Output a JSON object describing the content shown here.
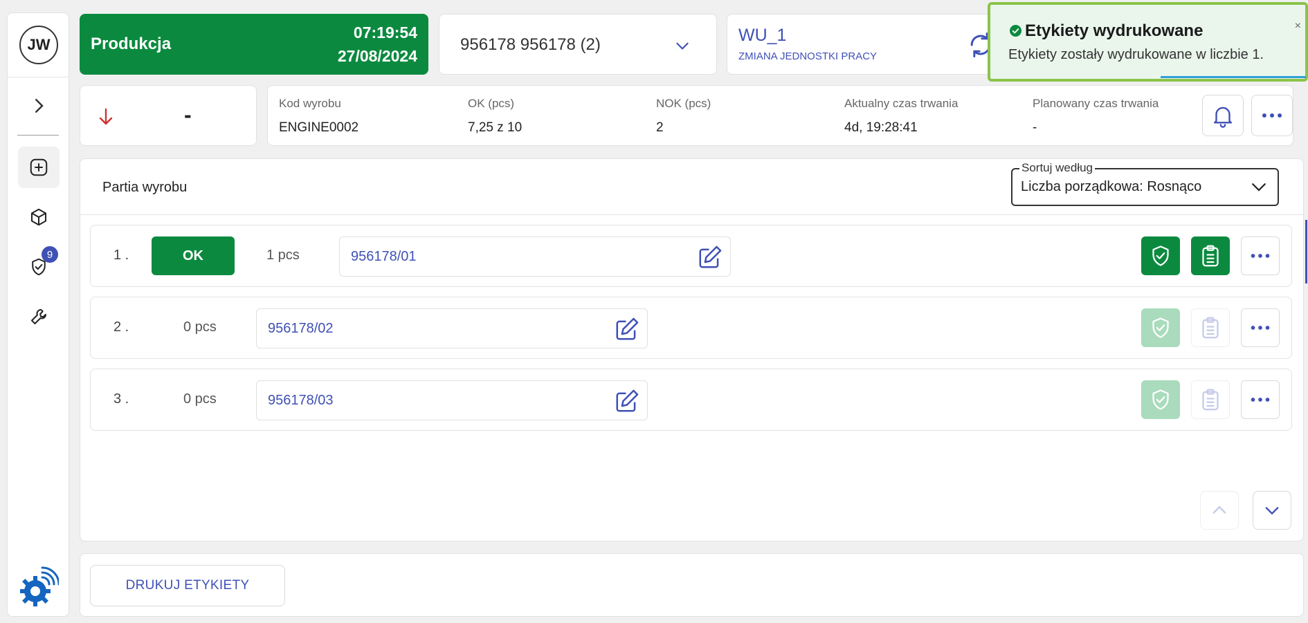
{
  "sidebar": {
    "avatar_initials": "JW",
    "notification_count": "9",
    "items": [
      {
        "icon": "chevron-right-icon"
      },
      {
        "icon": "plus-square-icon",
        "active": true
      },
      {
        "icon": "cube-icon"
      },
      {
        "icon": "shield-check-icon"
      },
      {
        "icon": "wrench-icon"
      }
    ]
  },
  "header": {
    "status_title": "Produkcja",
    "time": "07:19:54",
    "date": "27/08/2024",
    "order_label": "956178 956178  (2)",
    "work_unit_title": "WU_1",
    "work_unit_action": "ZMIANA JEDNOSTKI PRACY"
  },
  "toast": {
    "title": "Etykiety wydrukowane",
    "message": "Etykiety zostały wydrukowane w liczbie 1.",
    "close": "×"
  },
  "status": {
    "trend": "down",
    "value": "-"
  },
  "info": [
    {
      "label": "Kod wyrobu",
      "value": "ENGINE0002"
    },
    {
      "label": "OK (pcs)",
      "value": "7,25 z 10"
    },
    {
      "label": "NOK (pcs)",
      "value": "2"
    },
    {
      "label": "Aktualny czas trwania",
      "value": "4d, 19:28:41"
    },
    {
      "label": "Planowany czas trwania",
      "value": "-"
    }
  ],
  "partia": {
    "title": "Partia wyrobu",
    "sort_label": "Sortuj według",
    "sort_value": "Liczba porządkowa: Rosnąco",
    "rows": [
      {
        "num": "1 .",
        "status": "OK",
        "qty": "1  pcs",
        "batch": "956178/01"
      },
      {
        "num": "2 .",
        "status": "",
        "qty": "0  pcs",
        "batch": "956178/02"
      },
      {
        "num": "3 .",
        "status": "",
        "qty": "0  pcs",
        "batch": "956178/03"
      }
    ]
  },
  "footer": {
    "print_button": "DRUKUJ ETYKIETY"
  },
  "colors": {
    "primary_green": "#0b8a3f",
    "accent_blue": "#3f51b5",
    "toast_border": "#8bc34a",
    "error_red": "#d32f2f"
  }
}
